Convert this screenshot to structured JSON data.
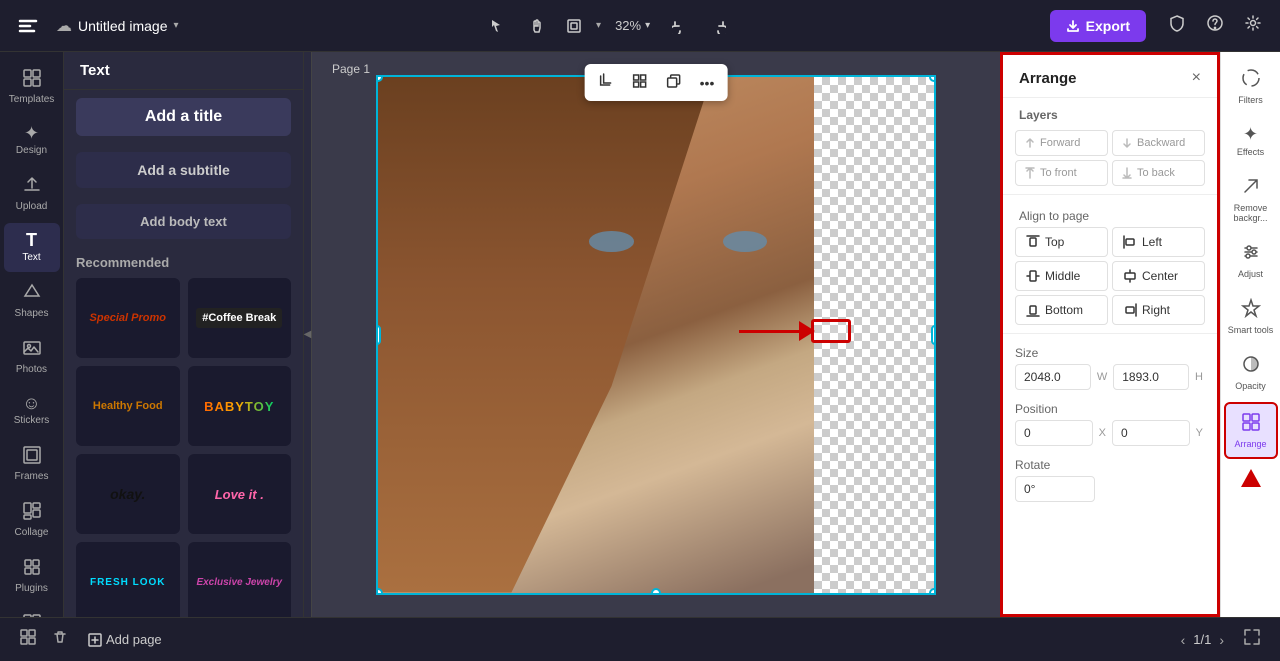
{
  "header": {
    "logo": "✕",
    "doc_title": "Untitled image",
    "chevron": "▾",
    "export_label": "Export",
    "zoom_level": "32%",
    "undo_icon": "↩",
    "redo_icon": "↪"
  },
  "left_sidebar": {
    "items": [
      {
        "id": "templates",
        "icon": "⊞",
        "label": "Templates"
      },
      {
        "id": "design",
        "icon": "✦",
        "label": "Design"
      },
      {
        "id": "upload",
        "icon": "⬆",
        "label": "Upload"
      },
      {
        "id": "text",
        "icon": "T",
        "label": "Text"
      },
      {
        "id": "shapes",
        "icon": "◇",
        "label": "Shapes"
      },
      {
        "id": "photos",
        "icon": "🖼",
        "label": "Photos"
      },
      {
        "id": "stickers",
        "icon": "☺",
        "label": "Stickers"
      },
      {
        "id": "frames",
        "icon": "⬜",
        "label": "Frames"
      },
      {
        "id": "collage",
        "icon": "▤",
        "label": "Collage"
      },
      {
        "id": "plugins",
        "icon": "⧉",
        "label": "Plugins"
      }
    ]
  },
  "text_panel": {
    "header": "Text",
    "buttons": {
      "title": "Add a title",
      "subtitle": "Add a subtitle",
      "body": "Add body text"
    },
    "recommended_label": "Recommended",
    "templates": [
      {
        "id": "special-promo",
        "text": "Special Promo",
        "style": "tmpl-special-promo"
      },
      {
        "id": "coffee-break",
        "text": "#Coffee Break",
        "style": "tmpl-coffee"
      },
      {
        "id": "healthy-food",
        "text": "Healthy Food",
        "style": "tmpl-healthy"
      },
      {
        "id": "babytoy",
        "text": "BABYTOY",
        "style": "tmpl-babytoy"
      },
      {
        "id": "okay",
        "text": "okay.",
        "style": "tmpl-okay"
      },
      {
        "id": "love-it",
        "text": "Love it .",
        "style": "tmpl-loveit"
      },
      {
        "id": "fresh-look",
        "text": "FRESH LOOK",
        "style": "tmpl-fresh"
      },
      {
        "id": "exclusive-jewelry",
        "text": "Exclusive Jewelry",
        "style": "tmpl-exclusive"
      }
    ]
  },
  "canvas": {
    "page_label": "Page 1",
    "toolbar_buttons": [
      "crop",
      "grid",
      "duplicate",
      "more"
    ]
  },
  "arrange_panel": {
    "title": "Arrange",
    "close_label": "×",
    "layers_section": "Layers",
    "layer_buttons": [
      "Forward",
      "Backward",
      "To front",
      "To back"
    ],
    "align_section": "Align to page",
    "align_buttons": [
      {
        "id": "top",
        "icon": "⊤",
        "label": "Top"
      },
      {
        "id": "left",
        "icon": "⊣",
        "label": "Left"
      },
      {
        "id": "middle",
        "icon": "↕",
        "label": "Middle"
      },
      {
        "id": "center",
        "icon": "↔",
        "label": "Center"
      },
      {
        "id": "bottom",
        "icon": "⊥",
        "label": "Bottom"
      },
      {
        "id": "right",
        "icon": "⊢",
        "label": "Right"
      }
    ],
    "size_section": "Size",
    "size_w": "2048.0",
    "size_h": "1893.0",
    "position_section": "Position",
    "pos_x": "0",
    "pos_y": "0",
    "rotate_section": "Rotate",
    "rotate_value": "0°"
  },
  "right_icon_bar": {
    "items": [
      {
        "id": "filters",
        "icon": "◑",
        "label": "Filters"
      },
      {
        "id": "effects",
        "icon": "✦",
        "label": "Effects"
      },
      {
        "id": "remove-bg",
        "icon": "✂",
        "label": "Remove backgr..."
      },
      {
        "id": "adjust",
        "icon": "⚙",
        "label": "Adjust"
      },
      {
        "id": "smart-tools",
        "icon": "◈",
        "label": "Smart tools"
      },
      {
        "id": "opacity",
        "icon": "◎",
        "label": "Opacity"
      },
      {
        "id": "arrange",
        "icon": "⧉",
        "label": "Arrange"
      }
    ]
  },
  "bottom_bar": {
    "add_page_label": "Add page",
    "page_current": "1",
    "page_total": "1",
    "page_indicator": "1/1"
  }
}
